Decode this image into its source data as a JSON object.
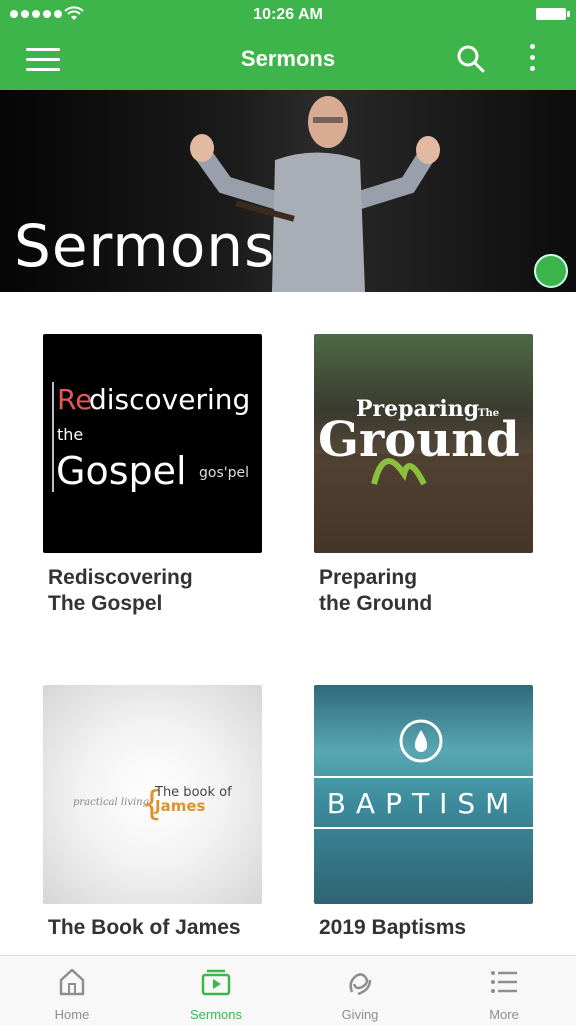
{
  "status_bar": {
    "time": "10:26 AM"
  },
  "nav": {
    "title": "Sermons"
  },
  "hero": {
    "title": "Sermons"
  },
  "series": [
    {
      "label": "Rediscovering\nThe Gospel",
      "art": {
        "line1_accent": "Re",
        "line1_rest": "discovering",
        "line2": "the",
        "line3": "Gospel",
        "note": "gos'pel"
      }
    },
    {
      "label": "Preparing\nthe Ground",
      "art": {
        "top": "Preparing",
        "small": "The",
        "big": "Ground"
      }
    },
    {
      "label": "The Book of James",
      "art": {
        "left": "practical living",
        "right_top": "The book of",
        "right_bottom": "James"
      }
    },
    {
      "label": "2019 Baptisms",
      "art": {
        "word": "BAPTISM"
      }
    }
  ],
  "tabs": [
    {
      "label": "Home",
      "icon": "home-icon",
      "active": false
    },
    {
      "label": "Sermons",
      "icon": "play-icon",
      "active": true
    },
    {
      "label": "Giving",
      "icon": "giving-icon",
      "active": false
    },
    {
      "label": "More",
      "icon": "list-icon",
      "active": false
    }
  ],
  "colors": {
    "brand": "#3db54a",
    "tab_inactive": "#8e8e8e"
  }
}
